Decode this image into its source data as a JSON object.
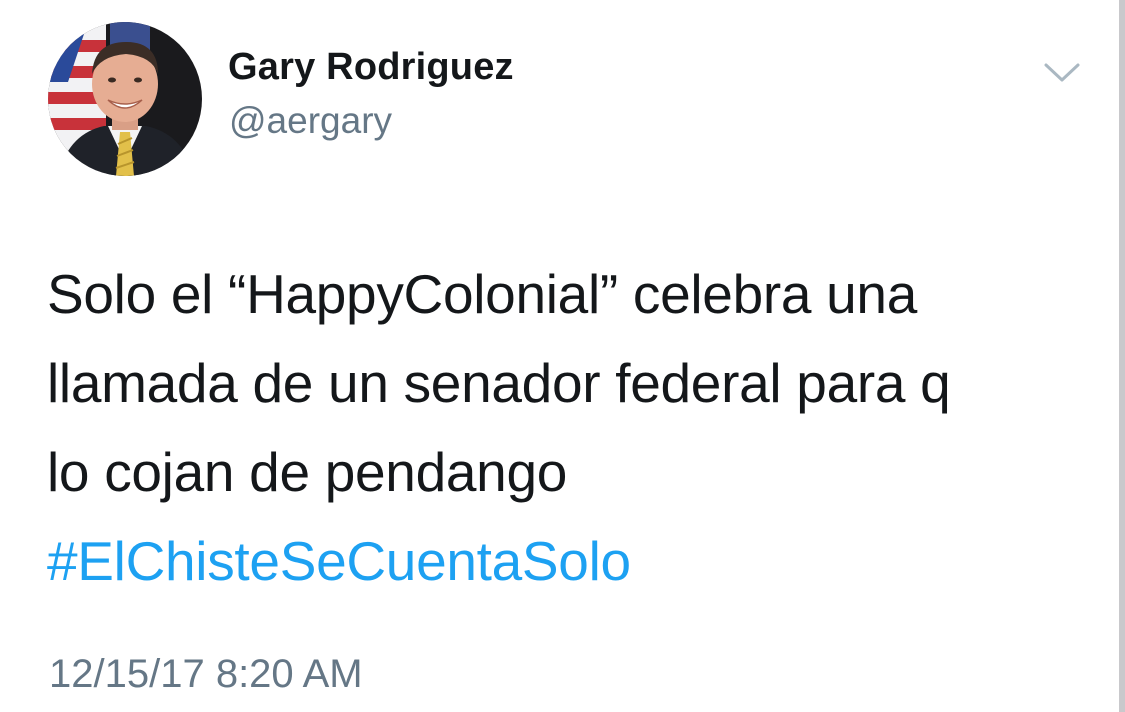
{
  "user": {
    "display_name": "Gary Rodriguez",
    "handle": "@aergary",
    "avatar_icon": "profile-photo"
  },
  "tweet": {
    "text_lines": [
      "Solo el “HappyColonial” celebra una",
      "llamada de un senador federal para q",
      "lo cojan de pendango"
    ],
    "hashtag": "#ElChisteSeCuentaSolo",
    "timestamp": "12/15/17 8:20 AM"
  },
  "menu": {
    "icon": "chevron-down-icon"
  },
  "colors": {
    "text": "#14171a",
    "secondary": "#657786",
    "link": "#1da1f2",
    "background": "#ffffff"
  }
}
